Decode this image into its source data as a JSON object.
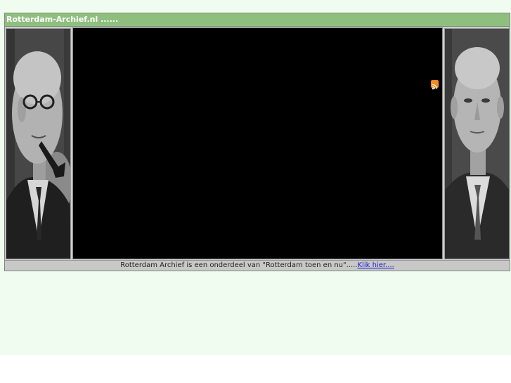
{
  "header": {
    "title": "Rotterdam-Archief.nl ......"
  },
  "footer": {
    "text": "Rotterdam Archief is een onderdeel van \"Rotterdam toen en nu\".....",
    "link_label": "Klik hier...."
  },
  "icons": {
    "rss": "rss-icon"
  },
  "colors": {
    "page_background": "#f0fcf0",
    "title_bar": "#8fbf7f",
    "video_background": "#000000",
    "footer_bar": "#c8c8c8",
    "link": "#1a1ad0",
    "rss": "#f08a24"
  }
}
